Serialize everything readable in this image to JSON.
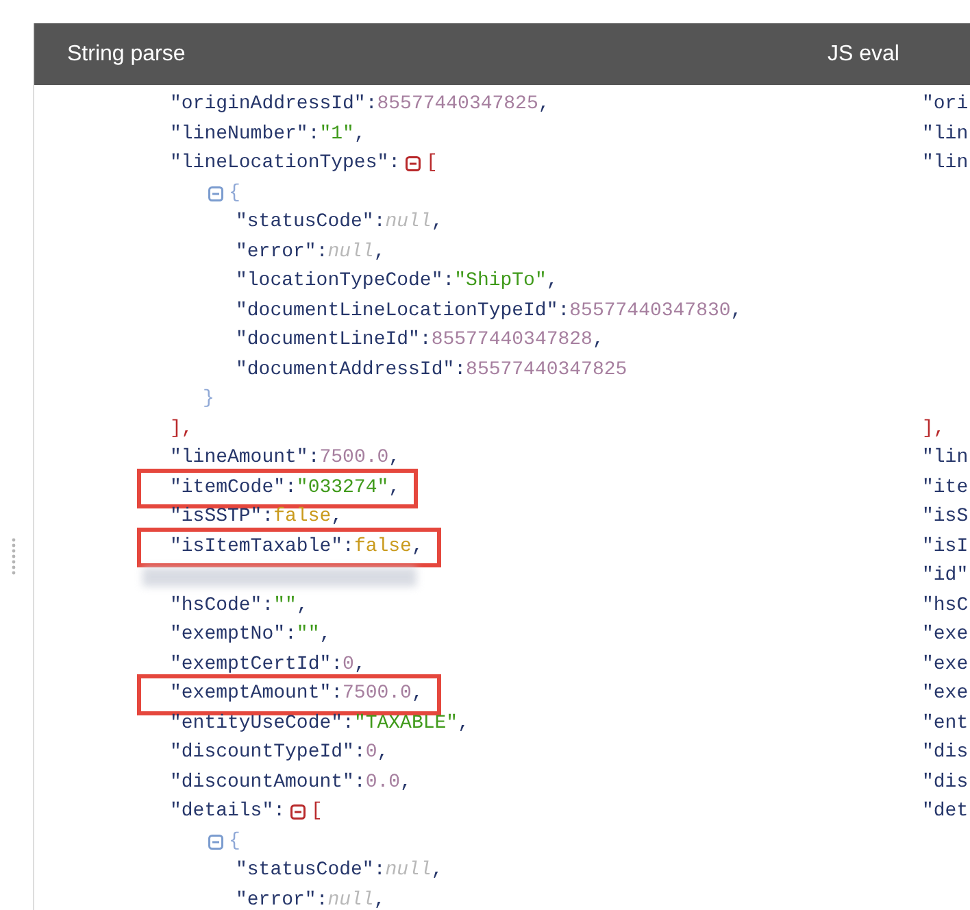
{
  "string_parse": {
    "title": "String parse",
    "lines": [
      {
        "kind": "number",
        "key": "\"originAddressId\"",
        "sep": ":",
        "value": "85577440347825",
        "tail": ",",
        "highlighted": false
      },
      {
        "kind": "string",
        "key": "\"lineNumber\"",
        "sep": ":",
        "value": "\"1\"",
        "tail": ",",
        "highlighted": false
      },
      {
        "kind": "array",
        "key": "\"lineLocationTypes\"",
        "sep": ":",
        "open": "[",
        "expanded": true,
        "close": "],",
        "children": [
          {
            "kind": "object",
            "open": "{",
            "expanded": true,
            "close": "}",
            "children": [
              {
                "kind": "null",
                "key": "\"statusCode\"",
                "sep": ":",
                "value": "null",
                "tail": ",",
                "highlighted": false
              },
              {
                "kind": "null",
                "key": "\"error\"",
                "sep": ":",
                "value": "null",
                "tail": ",",
                "highlighted": false
              },
              {
                "kind": "string",
                "key": "\"locationTypeCode\"",
                "sep": ":",
                "value": "\"ShipTo\"",
                "tail": ",",
                "highlighted": false
              },
              {
                "kind": "number",
                "key": "\"documentLineLocationTypeId\"",
                "sep": ":",
                "value": "85577440347830",
                "tail": ",",
                "highlighted": false
              },
              {
                "kind": "number",
                "key": "\"documentLineId\"",
                "sep": ":",
                "value": "85577440347828",
                "tail": ",",
                "highlighted": false
              },
              {
                "kind": "number",
                "key": "\"documentAddressId\"",
                "sep": ":",
                "value": "85577440347825",
                "highlighted": false
              }
            ]
          }
        ]
      },
      {
        "kind": "number",
        "key": "\"lineAmount\"",
        "sep": ":",
        "value": "7500.0",
        "tail": ",",
        "highlighted": false
      },
      {
        "kind": "string",
        "key": "\"itemCode\"",
        "sep": ":",
        "value": "\"033274\"",
        "tail": ",",
        "highlighted": true
      },
      {
        "kind": "boolean",
        "key": "\"isSSTP\"",
        "sep": ":",
        "value": "false",
        "tail": ",",
        "highlighted": false
      },
      {
        "kind": "boolean",
        "key": "\"isItemTaxable\"",
        "sep": ":",
        "value": "false",
        "tail": ",",
        "highlighted": true
      },
      {
        "kind": "redacted"
      },
      {
        "kind": "string",
        "key": "\"hsCode\"",
        "sep": ":",
        "value": "\"\"",
        "tail": ",",
        "highlighted": false
      },
      {
        "kind": "string",
        "key": "\"exemptNo\"",
        "sep": ":",
        "value": "\"\"",
        "tail": ",",
        "highlighted": false
      },
      {
        "kind": "number",
        "key": "\"exemptCertId\"",
        "sep": ":",
        "value": "0",
        "tail": ",",
        "highlighted": false
      },
      {
        "kind": "number",
        "key": "\"exemptAmount\"",
        "sep": ":",
        "value": "7500.0",
        "tail": ",",
        "highlighted": true
      },
      {
        "kind": "string",
        "key": "\"entityUseCode\"",
        "sep": ":",
        "value": "\"TAXABLE\"",
        "tail": ",",
        "highlighted": false
      },
      {
        "kind": "number",
        "key": "\"discountTypeId\"",
        "sep": ":",
        "value": "0",
        "tail": ",",
        "highlighted": false
      },
      {
        "kind": "number",
        "key": "\"discountAmount\"",
        "sep": ":",
        "value": "0.0",
        "tail": ",",
        "highlighted": false
      },
      {
        "kind": "array",
        "key": "\"details\"",
        "sep": ":",
        "open": "[",
        "expanded": true,
        "children": [
          {
            "kind": "object",
            "open": "{",
            "expanded": true,
            "children": [
              {
                "kind": "null",
                "key": "\"statusCode\"",
                "sep": ":",
                "value": "null",
                "tail": ",",
                "highlighted": false
              },
              {
                "kind": "null",
                "key": "\"error\"",
                "sep": ":",
                "value": "null",
                "tail": ",",
                "highlighted": false
              }
            ]
          }
        ]
      }
    ]
  },
  "js_eval": {
    "title": "JS eval",
    "lines": [
      {
        "kind": "text",
        "text": "\"ori"
      },
      {
        "kind": "text",
        "text": "\"lin"
      },
      {
        "kind": "text",
        "text": "\"lin"
      },
      {
        "kind": "blank"
      },
      {
        "kind": "blank"
      },
      {
        "kind": "blank"
      },
      {
        "kind": "blank"
      },
      {
        "kind": "blank"
      },
      {
        "kind": "blank"
      },
      {
        "kind": "blank"
      },
      {
        "kind": "blank"
      },
      {
        "kind": "bracket",
        "text": "],"
      },
      {
        "kind": "text",
        "text": "\"lin"
      },
      {
        "kind": "text",
        "text": "\"ite"
      },
      {
        "kind": "text",
        "text": "\"isS"
      },
      {
        "kind": "text",
        "text": "\"isI"
      },
      {
        "kind": "text",
        "text": "\"id\""
      },
      {
        "kind": "text",
        "text": "\"hsC"
      },
      {
        "kind": "text",
        "text": "\"exe"
      },
      {
        "kind": "text",
        "text": "\"exe"
      },
      {
        "kind": "text",
        "text": "\"exe"
      },
      {
        "kind": "text",
        "text": "\"ent"
      },
      {
        "kind": "text",
        "text": "\"dis"
      },
      {
        "kind": "text",
        "text": "\"dis"
      },
      {
        "kind": "text",
        "text": "\"det"
      }
    ]
  }
}
